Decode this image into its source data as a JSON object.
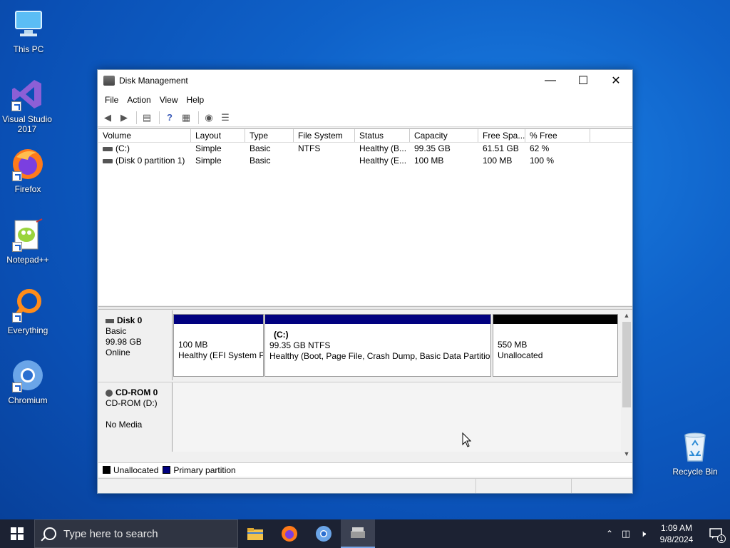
{
  "desktop": {
    "icons": [
      {
        "label": "This PC"
      },
      {
        "label": "Visual Studio 2017"
      },
      {
        "label": "Firefox"
      },
      {
        "label": "Notepad++"
      },
      {
        "label": "Everything"
      },
      {
        "label": "Chromium"
      },
      {
        "label": "Recycle Bin"
      }
    ]
  },
  "window": {
    "title": "Disk Management",
    "controls": {
      "minimize": "—",
      "maximize": "☐",
      "close": "✕"
    },
    "menu": [
      "File",
      "Action",
      "View",
      "Help"
    ],
    "columns": [
      "Volume",
      "Layout",
      "Type",
      "File System",
      "Status",
      "Capacity",
      "Free Spa...",
      "% Free"
    ],
    "volumes": [
      {
        "volume": "(C:)",
        "layout": "Simple",
        "type": "Basic",
        "fs": "NTFS",
        "status": "Healthy (B...",
        "capacity": "99.35 GB",
        "free": "61.51 GB",
        "pct": "62 %"
      },
      {
        "volume": "(Disk 0 partition 1)",
        "layout": "Simple",
        "type": "Basic",
        "fs": "",
        "status": "Healthy (E...",
        "capacity": "100 MB",
        "free": "100 MB",
        "pct": "100 %"
      }
    ],
    "disks": {
      "disk0": {
        "name": "Disk 0",
        "type": "Basic",
        "size": "99.98 GB",
        "state": "Online",
        "partitions": [
          {
            "title": "",
            "size": "100 MB",
            "status": "Healthy (EFI System P"
          },
          {
            "title": "(C:)",
            "size": "99.35 GB NTFS",
            "status": "Healthy (Boot, Page File, Crash Dump, Basic Data Partition"
          },
          {
            "title": "",
            "size": "550 MB",
            "status": "Unallocated"
          }
        ]
      },
      "cdrom0": {
        "name": "CD-ROM 0",
        "drive": "CD-ROM (D:)",
        "media": "No Media"
      }
    },
    "legend": {
      "unallocated": "Unallocated",
      "primary": "Primary partition"
    },
    "colors": {
      "primary": "#00007f",
      "unallocated": "#000000"
    }
  },
  "taskbar": {
    "search_placeholder": "Type here to search",
    "time": "1:09 AM",
    "date": "9/8/2024",
    "notifications": "1"
  }
}
